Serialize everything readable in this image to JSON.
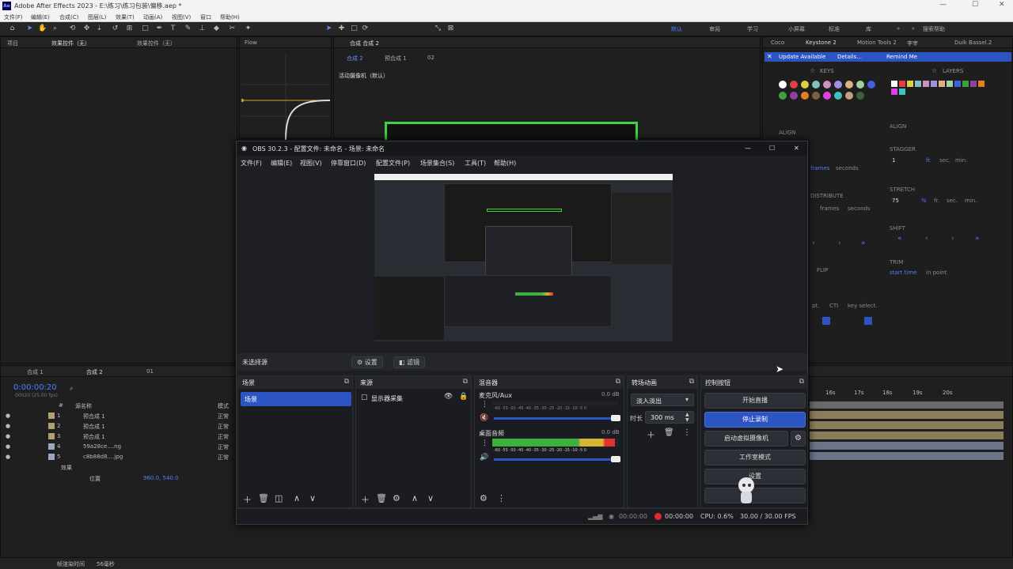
{
  "ae": {
    "title": "Adobe After Effects 2023 - E:\\练习\\练习包装\\偏移.aep *",
    "menu": [
      "文件(F)",
      "编辑(E)",
      "合成(C)",
      "图层(L)",
      "效果(T)",
      "动画(A)",
      "视图(V)",
      "窗口",
      "帮助(H)"
    ],
    "workspaces": [
      "默认",
      "审阅",
      "学习",
      "小屏幕",
      "标准",
      "库"
    ],
    "search_placeholder": "搜索帮助",
    "project_tab": "项目",
    "effects_tab": "效果控件（无）",
    "effects_tab2": "效果控件（无）",
    "flow_tab": "Flow",
    "comp_tab": "合成 合成 2",
    "comp_breadcrumb": [
      "合成 2",
      "预合成 1",
      "02"
    ],
    "camera_label": "活动摄像机（默认）",
    "right_tabs": [
      "Coco",
      "Keystone 2",
      "Motion Tools 2",
      "李宰",
      "Duik Bassel.2"
    ],
    "update_bar": {
      "text": "Update Available",
      "details": "Details...",
      "remind": "Remind Me"
    },
    "keys_label": "KEYS",
    "layers_label": "LAYERS",
    "align_label": "ALIGN",
    "stagger_label": "STAGGER",
    "stagger_value": "1",
    "stagger_units": [
      "fr.",
      "sec.",
      "min."
    ],
    "stretch_label": "STRETCH",
    "stretch_value": "75",
    "stretch_units": [
      "%",
      "fr.",
      "sec.",
      "min."
    ],
    "shift_label": "SHIFT",
    "trim_label": "TRIM",
    "trim_start": "start time",
    "trim_in": "in point",
    "distribute_label": "DISTRIBUTE",
    "dist_units": [
      "frames",
      "seconds"
    ],
    "flip_label": "FLIP",
    "cti_labels": [
      "pt.",
      "CTI",
      "key select."
    ],
    "frames_label": "frames",
    "seconds_label": "seconds",
    "timeline_tabs": [
      "合成 1",
      "合成 2",
      "01"
    ],
    "timecode": "0:00:00:20",
    "timecode_sub": "00020 (25.00 fps)",
    "layer_header": {
      "num": "#",
      "name": "源名称",
      "mode": "模式"
    },
    "layers": [
      {
        "num": "1",
        "name": "预合成 1",
        "mode": "正常"
      },
      {
        "num": "2",
        "name": "预合成 1",
        "mode": "正常"
      },
      {
        "num": "3",
        "name": "预合成 1",
        "mode": "正常"
      },
      {
        "num": "4",
        "name": "59a28ce....ng",
        "mode": "正常"
      },
      {
        "num": "5",
        "name": "c8b88d8....jpg",
        "mode": "正常"
      }
    ],
    "effects_row": "效果",
    "position_row": {
      "label": "位置",
      "value": "960.0, 540.0"
    },
    "ruler": [
      "16s",
      "17s",
      "18s",
      "19s",
      "20s"
    ],
    "render_label": "帧渲染时间",
    "render_value": "56毫秒"
  },
  "obs": {
    "title": "OBS 30.2.3 - 配置文件: 未命名 - 场景: 未命名",
    "menu": [
      "文件(F)",
      "编辑(E)",
      "视图(V)",
      "停靠窗口(D)",
      "配置文件(P)",
      "场景集合(S)",
      "工具(T)",
      "帮助(H)"
    ],
    "no_source": "未选择源",
    "settings_btn": "设置",
    "filters_btn": "滤镜",
    "scenes": {
      "title": "场景",
      "items": [
        "场景"
      ]
    },
    "sources": {
      "title": "来源",
      "items": [
        "显示器采集"
      ]
    },
    "mixer": {
      "title": "混音器",
      "channels": [
        {
          "name": "麦克风/Aux",
          "db": "0.0 dB",
          "scale": "-60 -55 -50 -45 -40 -35 -30 -25 -20 -15 -10 -5 0",
          "level": 0
        },
        {
          "name": "桌面音频",
          "db": "0.0 dB",
          "scale": "-60 -55 -50 -45 -40 -35 -30 -25 -20 -15 -10 -5 0",
          "level": 0.97
        }
      ]
    },
    "transitions": {
      "title": "转场动画",
      "selected": "淡入淡出",
      "duration_label": "时长",
      "duration": "300 ms"
    },
    "controls": {
      "title": "控制按钮",
      "start_stream": "开始直播",
      "stop_record": "停止录制",
      "virtual_cam": "启动虚拟摄像机",
      "studio_mode": "工作室模式",
      "settings": "设置"
    },
    "status": {
      "stream_time": "00:00:00",
      "record_time": "00:00:00",
      "cpu": "CPU: 0.6%",
      "fps": "30.00 / 30.00 FPS"
    },
    "colors": {
      "accent": "#2c54c3",
      "record": "#e22a2a"
    }
  }
}
